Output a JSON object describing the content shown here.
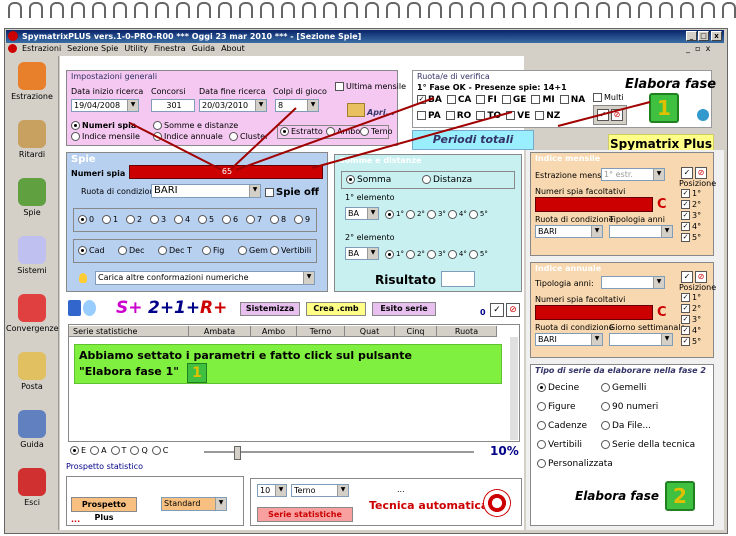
{
  "window": {
    "title": "SpymatrixPLUS vers.1-0-PRO-R00  ***  Oggi 23 mar 2010  ***  - [Sezione Spie]",
    "min": "_",
    "max": "□",
    "close": "x"
  },
  "menu": [
    "Estrazioni",
    "Sezione Spie",
    "Utility",
    "Finestra",
    "Guida",
    "About"
  ],
  "sidebar": [
    {
      "label": "Estrazione",
      "icon": "pencil-icon"
    },
    {
      "label": "Ritardi",
      "icon": "clock-icon"
    },
    {
      "label": "Spie",
      "icon": "flashlight-icon"
    },
    {
      "label": "Sistemi",
      "icon": "lightbulb-icon"
    },
    {
      "label": "Convergenze",
      "icon": "convergence-icon"
    },
    {
      "label": "Posta",
      "icon": "coin-icon"
    },
    {
      "label": "Guida",
      "icon": "book-icon"
    },
    {
      "label": "Esci",
      "icon": "exit-icon"
    }
  ],
  "general": {
    "title": "Impostazioni generali",
    "start_label": "Data inizio ricerca",
    "start_value": "19/04/2008",
    "contests_label": "Concorsi",
    "contests_value": "301",
    "end_label": "Data fine ricerca",
    "end_value": "20/03/2010",
    "shots_label": "Colpi di gioco",
    "shots_value": "8",
    "last_month": "Ultima mensile",
    "open": "Apri...",
    "opt_numeri_spia": "Numeri spia",
    "opt_indice_mensile": "Indice mensile",
    "opt_somme": "Somme e distanze",
    "opt_indice_annuale": "Indice annuale",
    "opt_cluster": "Cluster",
    "opt_estratto": "Estratto",
    "opt_ambo": "Ambo",
    "opt_terno": "Terno"
  },
  "ruota": {
    "title": "Ruota/e di verifica",
    "status": "1° Fase OK - Presenze spie: 14+1",
    "wheels_row1": [
      "BA",
      "CA",
      "FI",
      "GE",
      "MI",
      "NA"
    ],
    "wheels_row2": [
      "PA",
      "RO",
      "TO",
      "VE",
      "NZ"
    ],
    "multi": "Multi",
    "elabora": "Elabora fase",
    "periodi": "Periodi totali",
    "brand": "Spymatrix Plus",
    "badge1": "1",
    "badge2": "2"
  },
  "spie": {
    "title": "Spie",
    "numbers_label": "Numeri spia",
    "numbers_value": "65",
    "wheel_label": "Ruota di condizione",
    "wheel_value": "BARI",
    "spie_off": "Spie off",
    "digits": [
      "0",
      "1",
      "2",
      "3",
      "4",
      "5",
      "6",
      "7",
      "8",
      "9"
    ],
    "types": [
      "Cad",
      "Dec",
      "Dec T",
      "Fig",
      "Gem",
      "Vertibili"
    ],
    "load_more": "Carica altre conformazioni numeriche"
  },
  "somme": {
    "title": "Somme e distanze",
    "somma": "Somma",
    "distanza": "Distanza",
    "el1": "1° elemento",
    "el2": "2° elemento",
    "ba": "BA",
    "pos": [
      "1°",
      "2°",
      "3°",
      "4°",
      "5°"
    ],
    "risultato": "Risultato"
  },
  "toolbar": {
    "s_plus": "S+",
    "two_plus": "2+",
    "one_plus": "1+",
    "r_plus": "R+",
    "sistemizza": "Sistemizza",
    "crea": "Crea .cmb",
    "esito": "Esito serie",
    "count": "0"
  },
  "table": {
    "headers": [
      "Serie statistiche",
      "Ambata",
      "Ambo",
      "Terno",
      "Quat",
      "Cinq",
      "Ruota"
    ]
  },
  "overlay": {
    "line1": "Abbiamo settato i parametri e fatto click sul pulsante",
    "line2": "\"Elabora fase 1\""
  },
  "bottom": {
    "filters": [
      "E",
      "A",
      "T",
      "Q",
      "C"
    ],
    "percent": "10%",
    "prospetto_label": "Prospetto statistico",
    "prospetto_plus": "Prospetto Plus",
    "standard": "Standard",
    "dots": "...",
    "colpi": "10",
    "sorte": "Terno",
    "serie_btn": "Serie statistiche",
    "tecnica": "Tecnica automatica"
  },
  "mensile": {
    "title": "Indice mensile",
    "estr_label": "Estrazione mensile:",
    "estr_value": "1° estr.",
    "num_label": "Numeri spia facoltativi",
    "c": "C",
    "ruota_label": "Ruota di condizione",
    "ruota_value": "BARI",
    "tip_label": "Tipologia anni",
    "posizione": "Posizione",
    "pos": [
      "1°",
      "2°",
      "3°",
      "4°",
      "5°"
    ]
  },
  "annuale": {
    "title": "Indice annuale",
    "tip_label": "Tipologia anni:",
    "num_label": "Numeri spia facoltativi",
    "c": "C",
    "ruota_label": "Ruota di condizione",
    "ruota_value": "BARI",
    "giorno_label": "Giorno settimanale",
    "posizione": "Posizione",
    "pos": [
      "1°",
      "2°",
      "3°",
      "4°",
      "5°"
    ]
  },
  "tipo": {
    "title": "Tipo di serie da elaborare nella fase 2",
    "options_left": [
      "Decine",
      "Figure",
      "Cadenze",
      "Vertibili",
      "Personalizzata"
    ],
    "options_right": [
      "Gemelli",
      "90 numeri",
      "Da File...",
      "Serie della tecnica"
    ],
    "elabora2": "Elabora fase"
  }
}
